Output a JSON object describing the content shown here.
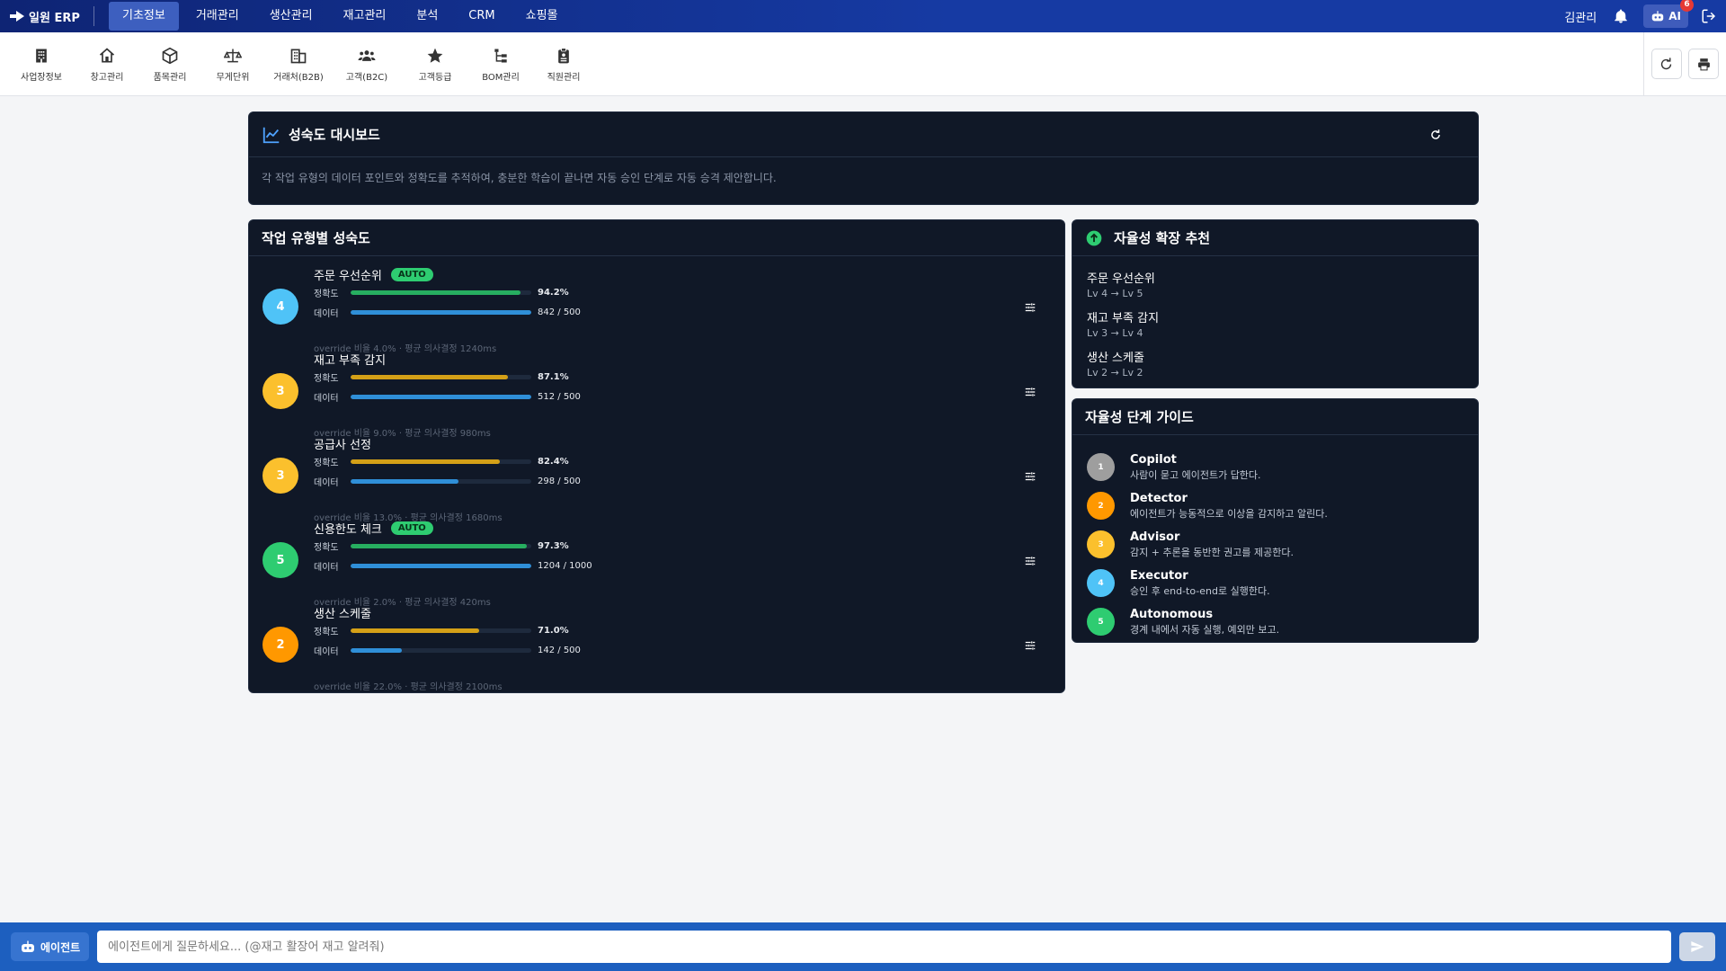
{
  "app": {
    "logo_text": "일원 ERP",
    "user_name": "김관리",
    "ai_label": "AI",
    "ai_badge": "6"
  },
  "nav": [
    {
      "label": "기초정보",
      "active": true
    },
    {
      "label": "거래관리"
    },
    {
      "label": "생산관리"
    },
    {
      "label": "재고관리"
    },
    {
      "label": "분석"
    },
    {
      "label": "CRM"
    },
    {
      "label": "쇼핑몰"
    }
  ],
  "toolbar": [
    {
      "label": "사업장정보",
      "icon": "building-icon"
    },
    {
      "label": "창고관리",
      "icon": "home-icon"
    },
    {
      "label": "품목관리",
      "icon": "box-icon"
    },
    {
      "label": "무게단위",
      "icon": "scale-icon"
    },
    {
      "label": "거래처(B2B)",
      "icon": "office-icon"
    },
    {
      "label": "고객(B2C)",
      "icon": "users-icon"
    },
    {
      "label": "고객등급",
      "icon": "star-icon"
    },
    {
      "label": "BOM관리",
      "icon": "tree-icon"
    },
    {
      "label": "직원관리",
      "icon": "badge-icon"
    }
  ],
  "dashboard": {
    "title": "성숙도 대시보드",
    "description": "각 작업 유형의 데이터 포인트와 정확도를 추적하여, 충분한 학습이 끝나면 자동 승인 단계로 자동 승격 제안합니다."
  },
  "maturity": {
    "title": "작업 유형별 성숙도",
    "accuracy_label": "정확도",
    "data_label": "데이터",
    "auto_label": "AUTO",
    "tasks": [
      {
        "name": "주문 우선순위",
        "level": "4",
        "auto": true,
        "accuracy": 94.2,
        "accuracy_text": "94.2%",
        "data": 842,
        "data_target": 500,
        "data_text": "842 / 500",
        "footer": "override 비율 4.0% · 평균 의사결정 1240ms"
      },
      {
        "name": "재고 부족 감지",
        "level": "3",
        "auto": false,
        "accuracy": 87.1,
        "accuracy_text": "87.1%",
        "data": 512,
        "data_target": 500,
        "data_text": "512 / 500",
        "footer": "override 비율 9.0% · 평균 의사결정 980ms"
      },
      {
        "name": "공급사 선정",
        "level": "3",
        "auto": false,
        "accuracy": 82.4,
        "accuracy_text": "82.4%",
        "data": 298,
        "data_target": 500,
        "data_text": "298 / 500",
        "footer": "override 비율 13.0% · 평균 의사결정 1680ms"
      },
      {
        "name": "신용한도 체크",
        "level": "5",
        "auto": true,
        "accuracy": 97.3,
        "accuracy_text": "97.3%",
        "data": 1204,
        "data_target": 1000,
        "data_text": "1204 / 1000",
        "footer": "override 비율 2.0% · 평균 의사결정 420ms"
      },
      {
        "name": "생산 스케줄",
        "level": "2",
        "auto": false,
        "accuracy": 71.0,
        "accuracy_text": "71.0%",
        "data": 142,
        "data_target": 500,
        "data_text": "142 / 500",
        "footer": "override 비율 22.0% · 평균 의사결정 2100ms"
      }
    ]
  },
  "recommend": {
    "title": "자율성 확장 추천",
    "items": [
      {
        "name": "주문 우선순위",
        "levels": "Lv 4 → Lv 5"
      },
      {
        "name": "재고 부족 감지",
        "levels": "Lv 3 → Lv 4"
      },
      {
        "name": "생산 스케줄",
        "levels": "Lv 2 → Lv 2"
      }
    ]
  },
  "guide": {
    "title": "자율성 단계 가이드",
    "items": [
      {
        "num": "1",
        "name": "Copilot",
        "desc": "사람이 묻고 에이전트가 답한다."
      },
      {
        "num": "2",
        "name": "Detector",
        "desc": "에이전트가 능동적으로 이상을 감지하고 알린다."
      },
      {
        "num": "3",
        "name": "Advisor",
        "desc": "감지 + 추론을 동반한 권고를 제공한다."
      },
      {
        "num": "4",
        "name": "Executor",
        "desc": "승인 후 end-to-end로 실행한다."
      },
      {
        "num": "5",
        "name": "Autonomous",
        "desc": "경계 내에서 자동 실행, 예외만 보고."
      }
    ]
  },
  "agent": {
    "button_label": "에이전트",
    "placeholder": "에이전트에게 질문하세요... (@재고 활장어 재고 알려줘)"
  },
  "colors": {
    "level_1": "#9e9e9e",
    "level_2": "#ff9800",
    "level_3": "#fbc02d",
    "level_4": "#4fc3f7",
    "level_5": "#2ecc71",
    "accuracy_high": "#27ae60",
    "accuracy_mid": "#d4a017",
    "data_bar": "#2f8fd8"
  }
}
